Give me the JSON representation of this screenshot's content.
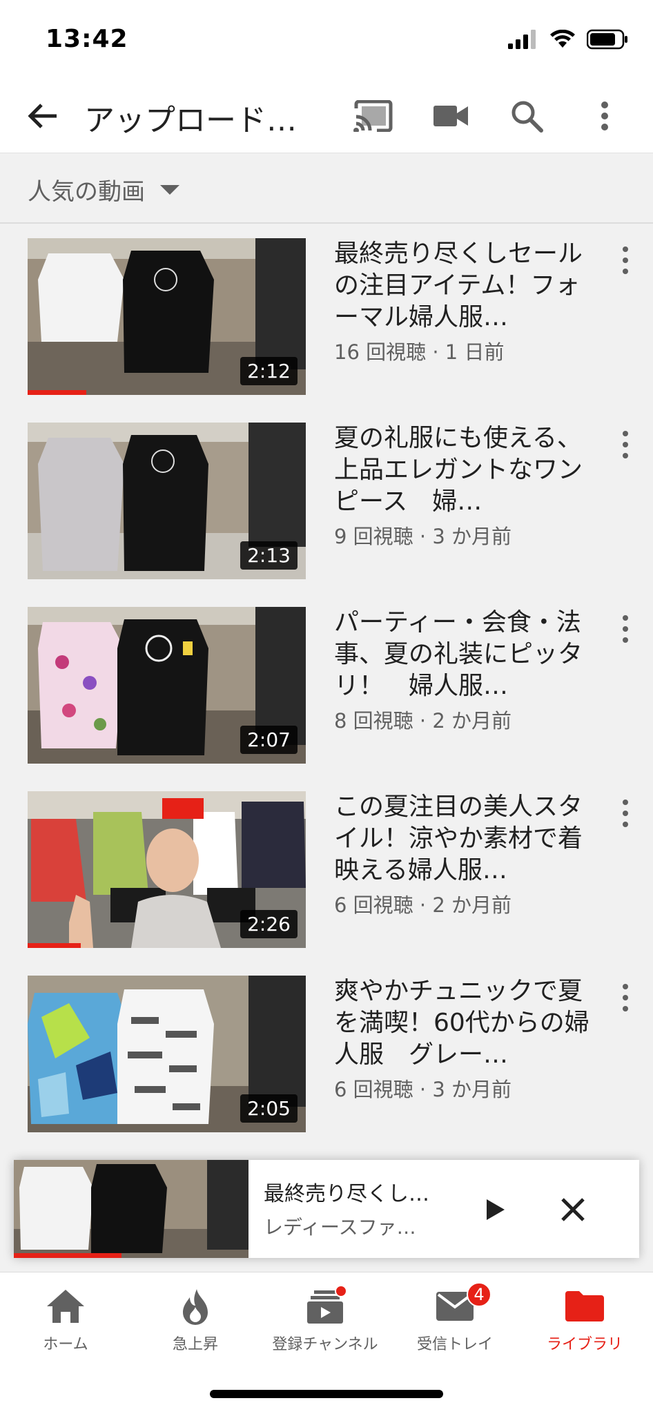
{
  "status": {
    "time": "13:42"
  },
  "app_bar": {
    "title": "アップロード…"
  },
  "sort": {
    "label": "人気の動画"
  },
  "videos": [
    {
      "title": "最終売り尽くしセールの注目アイテム！フォーマル婦人服…",
      "meta": "16 回視聴 · 1 日前",
      "duration": "2:12",
      "progress": 0.21
    },
    {
      "title": "夏の礼服にも使える、上品エレガントなワンピース　婦…",
      "meta": "9 回視聴 · 3 か月前",
      "duration": "2:13",
      "progress": 0
    },
    {
      "title": "パーティー・会食・法事、夏の礼装にピッタリ！　婦人服…",
      "meta": "8 回視聴 · 2 か月前",
      "duration": "2:07",
      "progress": 0
    },
    {
      "title": "この夏注目の美人スタイル！涼やか素材で着映える婦人服…",
      "meta": "6 回視聴 · 2 か月前",
      "duration": "2:26",
      "progress": 0.19
    },
    {
      "title": "爽やかチュニックで夏を満喫！60代からの婦人服　グレー…",
      "meta": "6 回視聴 · 3 か月前",
      "duration": "2:05",
      "progress": 0
    }
  ],
  "mini_player": {
    "title": "最終売り尽くし…",
    "channel": "レディースファ…",
    "progress": 0.46
  },
  "nav": {
    "items": [
      {
        "label": "ホーム"
      },
      {
        "label": "急上昇"
      },
      {
        "label": "登録チャンネル"
      },
      {
        "label": "受信トレイ",
        "badge": "4"
      },
      {
        "label": "ライブラリ"
      }
    ]
  },
  "colors": {
    "accent": "#e62117",
    "text_secondary": "#606060"
  }
}
